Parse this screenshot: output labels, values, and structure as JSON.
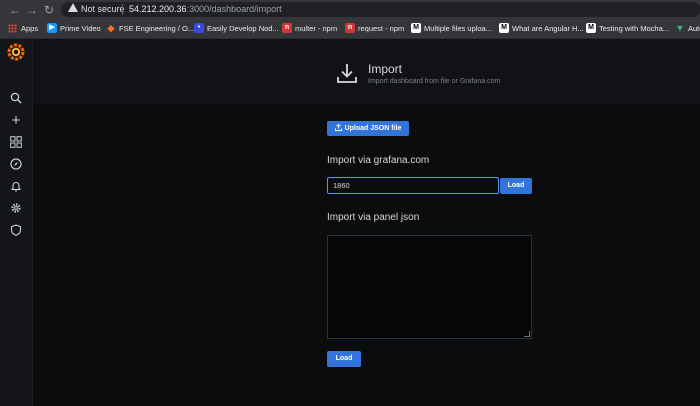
{
  "browser": {
    "security_label": "Not secure",
    "url_host": "54.212.200.36",
    "url_path": ":3000/dashboard/import"
  },
  "bookmarks": [
    {
      "label": "Apps",
      "icon": "apps-grid-icon"
    },
    {
      "label": "Prime Video",
      "icon": "prime-video-icon"
    },
    {
      "label": "FSE Engineering / O...",
      "icon": "gitlab-icon"
    },
    {
      "label": "Easily Develop Nod...",
      "icon": "devto-icon"
    },
    {
      "label": "multer - npm",
      "icon": "npm-icon"
    },
    {
      "label": "request - npm",
      "icon": "npm-icon"
    },
    {
      "label": "Multiple files uploa...",
      "icon": "medium-icon"
    },
    {
      "label": "What are Angular H...",
      "icon": "medium-icon"
    },
    {
      "label": "Testing with Mocha...",
      "icon": "medium-icon"
    },
    {
      "label": "Auto",
      "icon": "vue-icon"
    }
  ],
  "header": {
    "title": "Import",
    "subtitle": "Import dashboard from file or Grafana.com"
  },
  "upload_button": "Upload JSON file",
  "grafana_com": {
    "heading": "Import via grafana.com",
    "input_value": "1860",
    "load_label": "Load"
  },
  "panel_json": {
    "heading": "Import via panel json",
    "load_label": "Load"
  },
  "colors": {
    "accent": "#3274d9",
    "background": "#0b0c0e",
    "header_bg": "#111217"
  }
}
